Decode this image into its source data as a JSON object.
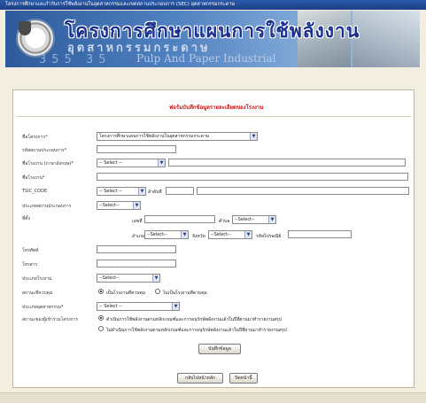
{
  "window": {
    "title": "โครงการศึกษาและกำกับการใช้พลังงานในอุตสาหกรรมและเขตสถานประกอบการ (SEC) อุตสาหกรรมกระดาษ"
  },
  "banner": {
    "title_main": "โครงการศึกษาแผนการใช้พลังงาน",
    "title_sub": "อุตสาหกรรมกระดาษ",
    "title_en": "Pulp And Paper Industrial",
    "numbers": "355 35"
  },
  "form": {
    "title": "ฟอร์มบันทึกข้อมูลรายละเอียดของโรงงาน",
    "project_label": "ชื่อโครงการ*",
    "project_value": "โครงการศึกษาแผนการใช้พลังงานในอุตสาหกรรมกระดาษ",
    "regno_label": "รหัสสถานประกอบการ*",
    "regno_value": "",
    "factory_en_label": "ชื่อโรงงาน (ภาษาอังกฤษ)*",
    "factory_en_select": "-- Select --",
    "factory_en_value": "",
    "factory_label": "ชื่อโรงงาน*",
    "factory_value": "",
    "tsic_label": "TSIC_CODE",
    "tsic_select": "-- Select --",
    "tsic_small_label": "ลำดับที่",
    "tsic_code_value": "",
    "tsic_desc_value": "",
    "biztype_label": "ประเภทสถานประกอบการ",
    "biztype_select": "--Select--",
    "address_label": "ที่ตั้ง",
    "house_no_label": "เลขที่",
    "house_no_value": "",
    "tambon_label": "ตำบล",
    "tambon_select": "--Select--",
    "amphoe_label": "อำเภอ",
    "amphoe_select": "--Select--",
    "province_label": "จังหวัด",
    "province_select": "--Select--",
    "postal_label": "รหัสไปรษณีย์",
    "postal_value": "",
    "phone_label": "โทรศัพท์",
    "phone_value": "",
    "fax_label": "โทรสาร",
    "fax_value": "",
    "factype_label": "ประเภทโรงงาน",
    "factype_select": "--Select--",
    "control_label": "สถานะที่ควบคุม",
    "control_opt1": "เป็นโรงงานที่ควบคุม",
    "control_opt2": "ไม่เป็นโรงงานที่ควบคุม",
    "industry_label": "ประเภทอุตสาหกรรม*",
    "industry_select": "-- Select --",
    "status_label": "สถานะของผู้เข้าร่วมโครงการ",
    "status_opt1": "ดำเนินการใช้พลังงานตามหลักเกณฑ์และการอนุรักษ์พลังงานแล้วในปีที่ผ่านมาทำรายงานสรุป",
    "status_opt2": "ไม่ดำเนินการใช้พลังงานตามหลักเกณฑ์และการอนุรักษ์พลังงานแล้วในปีที่ผ่านมาทำรายงานสรุป",
    "save_button": "บันทึกข้อมูล",
    "back_button": "กลับไปหน้าหลัก",
    "close_button": "ปิดหน้านี้"
  }
}
